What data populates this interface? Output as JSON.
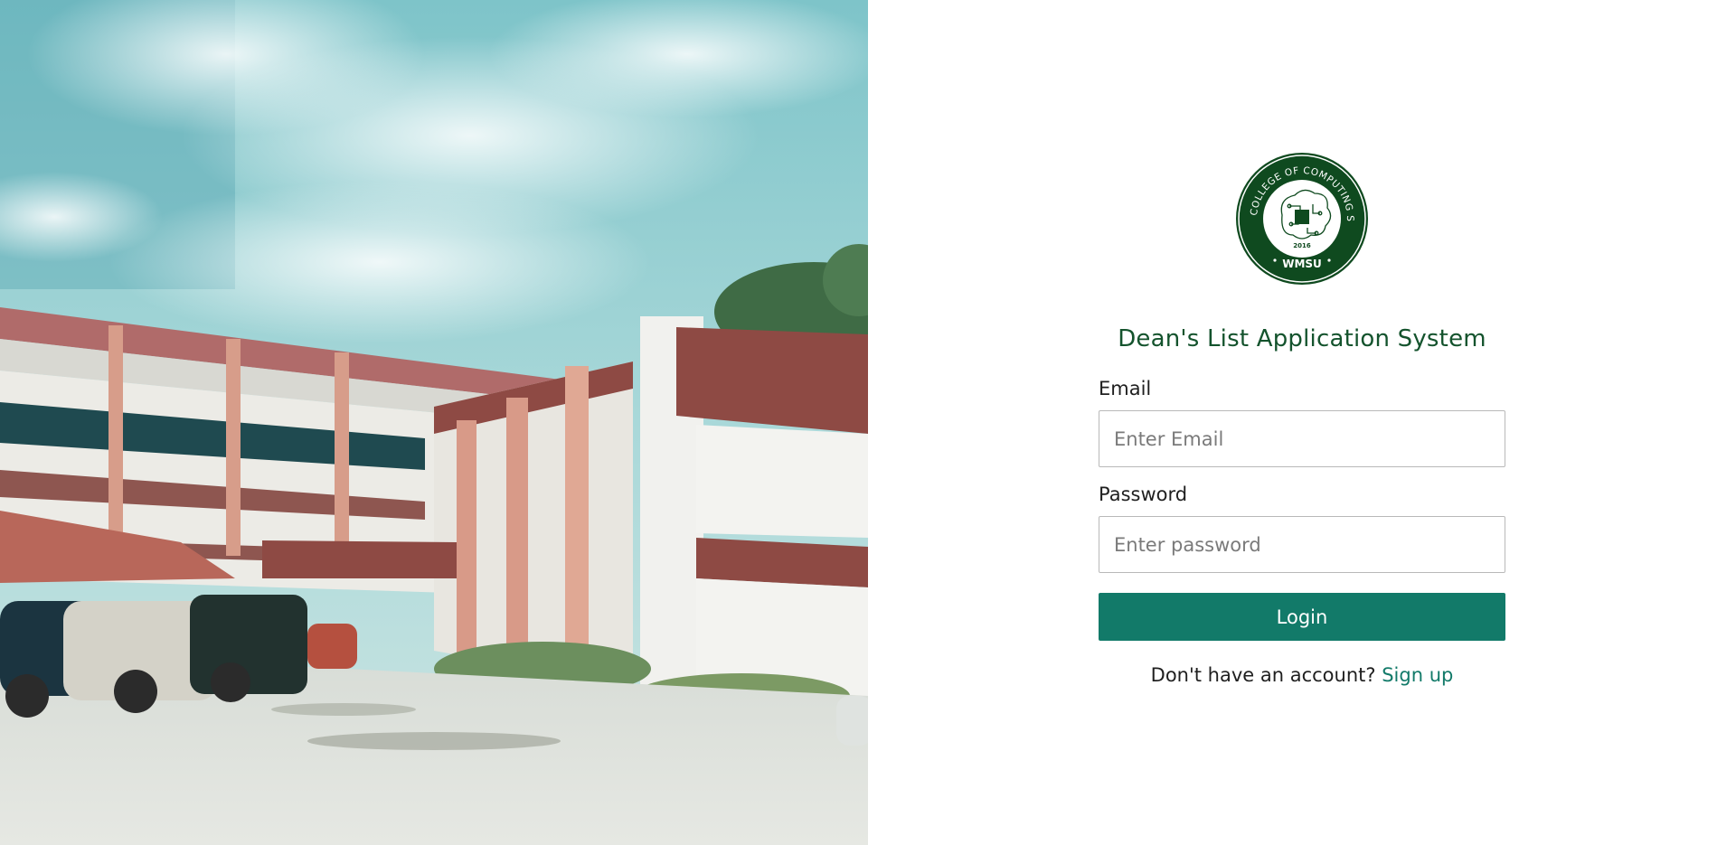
{
  "hero": {
    "image": "college-building-photo"
  },
  "logo": {
    "ring_text": "COLLEGE OF COMPUTING STUDIES",
    "year": "2016",
    "abbr": "WMSU",
    "color": "#0f4a1f"
  },
  "login": {
    "title": "Dean's List Application System",
    "email_label": "Email",
    "email_placeholder": "Enter Email",
    "email_value": "",
    "password_label": "Password",
    "password_placeholder": "Enter password",
    "password_value": "",
    "login_button": "Login",
    "signup_prompt": "Don't have an account?",
    "signup_link": "Sign up"
  },
  "colors": {
    "accent": "#127a69",
    "title": "#14532d"
  }
}
